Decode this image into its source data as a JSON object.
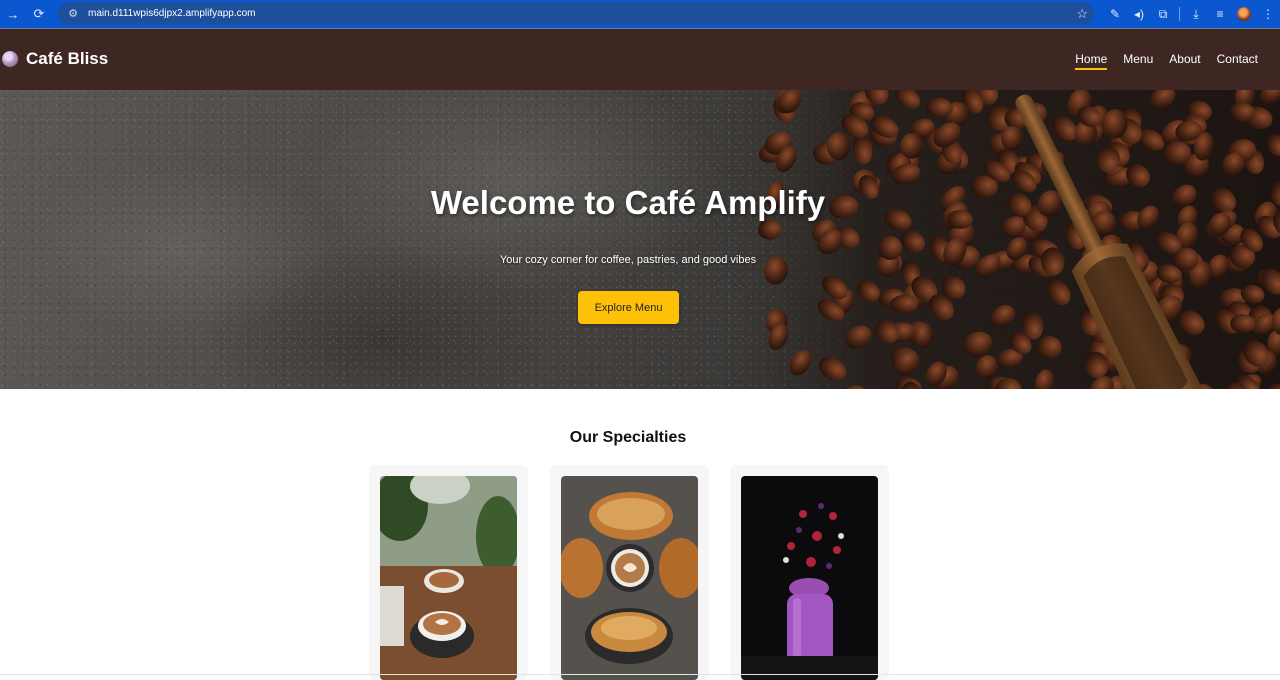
{
  "browser": {
    "url": "main.d111wpis6djpx2.amplifyapp.com",
    "icons": [
      "forward-icon",
      "reload-icon",
      "site-info-icon",
      "bookmark-star-icon",
      "pen-icon",
      "read-aloud-icon",
      "extensions-icon",
      "download-icon",
      "reading-list-icon",
      "profile-avatar",
      "menu-icon"
    ]
  },
  "navbar": {
    "brand": "Café Bliss",
    "links": [
      "Home",
      "Menu",
      "About",
      "Contact"
    ],
    "active": "Home",
    "background": "#3e2723",
    "accent": "#ffc107"
  },
  "hero": {
    "title": "Welcome to Café Amplify",
    "subtitle": "Your cozy corner for coffee, pastries, and good vibes",
    "button": "Explore Menu"
  },
  "specialties": {
    "title": "Our Specialties",
    "cards": [
      {
        "image": "latte-art-cups-with-plants"
      },
      {
        "image": "croissants-with-cappuccino"
      },
      {
        "image": "berry-smoothie-jar"
      }
    ]
  }
}
